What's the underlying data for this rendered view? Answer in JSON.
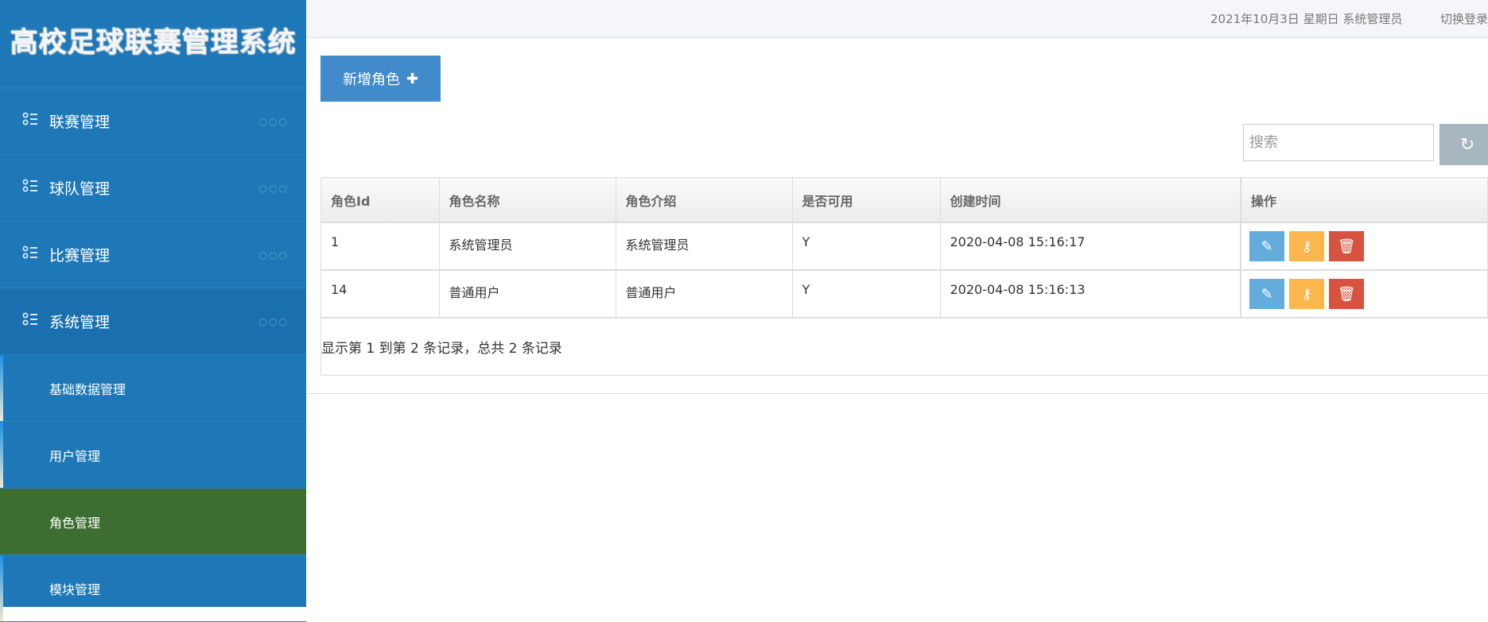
{
  "app": {
    "title": "高校足球联赛管理系统"
  },
  "sidebar": {
    "menus": [
      {
        "label": "联赛管理"
      },
      {
        "label": "球队管理"
      },
      {
        "label": "比赛管理"
      },
      {
        "label": "系统管理"
      }
    ],
    "submenus": [
      {
        "label": "基础数据管理"
      },
      {
        "label": "用户管理"
      },
      {
        "label": "角色管理"
      },
      {
        "label": "模块管理"
      }
    ],
    "dots": "○○○"
  },
  "header": {
    "date_user": "2021年10月3日 星期日 系统管理员",
    "switch_login": "切换登录"
  },
  "toolbar": {
    "add_label": "新增角色",
    "add_icon": "✚",
    "search_placeholder": "搜索",
    "refresh_icon": "↻"
  },
  "table": {
    "columns": [
      "角色Id",
      "角色名称",
      "角色介绍",
      "是否可用",
      "创建时间",
      "操作"
    ],
    "rows": [
      [
        "1",
        "系统管理员",
        "系统管理员",
        "Y",
        "2020-04-08 15:16:17"
      ],
      [
        "14",
        "普通用户",
        "普通用户",
        "Y",
        "2020-04-08 15:16:13"
      ]
    ]
  },
  "icons": {
    "edit": "✎",
    "key": "⚷",
    "delete": "🗑"
  },
  "pager": {
    "summary": "显示第 1 到第 2 条记录，总共 2 条记录"
  }
}
